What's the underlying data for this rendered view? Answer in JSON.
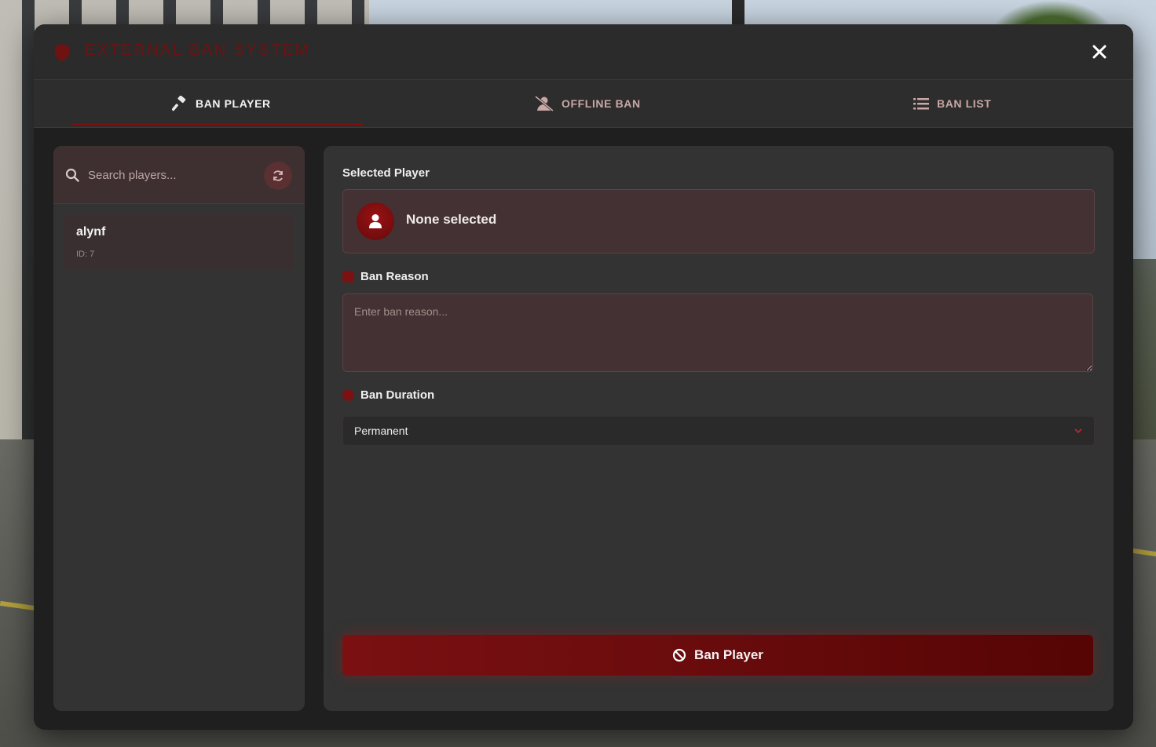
{
  "header": {
    "title": "EXTERNAL BAN SYSTEM",
    "icon": "shield-icon"
  },
  "tabs": [
    {
      "label": "BAN PLAYER",
      "icon": "gavel-icon",
      "active": true
    },
    {
      "label": "OFFLINE BAN",
      "icon": "user-slash-icon",
      "active": false
    },
    {
      "label": "BAN LIST",
      "icon": "list-icon",
      "active": false
    }
  ],
  "sidebar": {
    "search_placeholder": "Search players...",
    "players": [
      {
        "name": "alynf",
        "id_text": "ID: 7"
      }
    ]
  },
  "main": {
    "selected_label": "Selected Player",
    "selected_value": "None selected",
    "reason_label": "Ban Reason",
    "reason_placeholder": "Enter ban reason...",
    "duration_label": "Ban Duration",
    "duration_value": "Permanent",
    "ban_button": "Ban Player"
  },
  "colors": {
    "accent": "#7a1012",
    "panel": "#333333",
    "modal": "#1f1f1f"
  }
}
